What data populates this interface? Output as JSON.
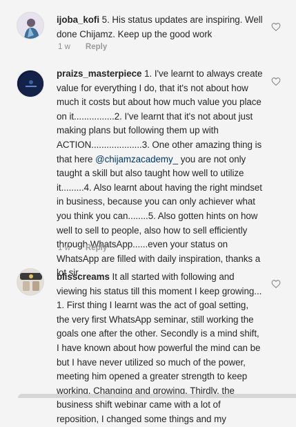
{
  "comments": [
    {
      "username": "ijoba_kofi",
      "text": " 5. His status updates are inspiring. Well done Chijamz. Keep up the good work",
      "time": "1 w",
      "reply": "Reply"
    },
    {
      "username": "praizs_masterpiece",
      "text_before": " 1. I've learnt to always create value for everything I do, that it's not about how much it costs but about how much value you place on it................2. I've learnt that it's not about just making plans but following them up with ACTION....................3. One other amazing thing is that here ",
      "mention": "@chijamzacademy_",
      "text_after": " you are not only taught a skill but also taught how well to utilize it.........4. Also learnt about having the right mindset in business, because you can only achiever what you think you can........5. Also gotten hints on how well to sell to people, also how to sell efficiently through WhatsApp......even your status on WhatsApp are filled with daily inspiration, thanks a lot sir.",
      "time": "1 w",
      "reply": "Reply"
    },
    {
      "username": "blisscreams",
      "text": " It all started with following and viewing his status till this moment I keep growing... 1. First thing I learnt was the act of goal setting, the very first WhatsApp seminar, still working the goals one after the other. Secondly is a mind shift, I have known about how powerful the mind can be but I have never utilized so much of the power, meeting him opened a greater strength to keep working, Changing and growing. Thirdly, the business shift webinar came with a lot of reposition, I changed some things and my"
    }
  ],
  "icons": {
    "like": "heart-outline-icon"
  },
  "colors": {
    "text": "#262626",
    "meta": "#8e8e8e",
    "mention": "#00376b",
    "background": "#f4f4f4"
  }
}
